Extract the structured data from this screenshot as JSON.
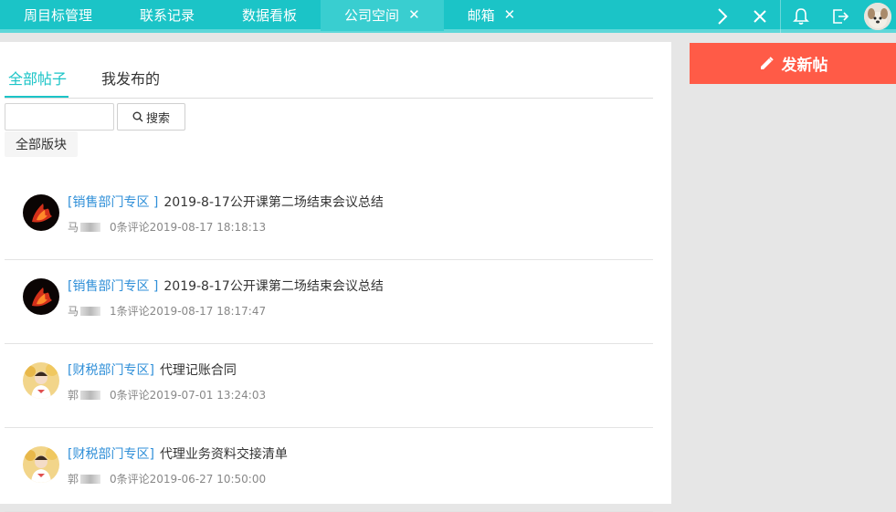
{
  "topnav": {
    "tabs": [
      {
        "label": "周目标管理"
      },
      {
        "label": "联系记录"
      },
      {
        "label": "数据看板"
      },
      {
        "label": "公司空间",
        "closable": true,
        "active": true
      },
      {
        "label": "邮箱",
        "closable": true
      }
    ],
    "icons": [
      "chevron-right-icon",
      "close-icon",
      "bell-icon",
      "logout-icon"
    ]
  },
  "tabs": {
    "all": "全部帖子",
    "mine": "我发布的"
  },
  "search": {
    "placeholder": "",
    "button": "搜索"
  },
  "board_filter": "全部版块",
  "posts": [
    {
      "board": "[销售部门专区 ]",
      "title": "2019-8-17公开课第二场结束会议总结",
      "author": "马",
      "comments": "0条评论",
      "time": "2019-08-17 18:18:13"
    },
    {
      "board": "[销售部门专区 ]",
      "title": "2019-8-17公开课第二场结束会议总结",
      "author": "马",
      "comments": "1条评论",
      "time": "2019-08-17 18:17:47"
    },
    {
      "board": "[财税部门专区]",
      "title": "代理记账合同",
      "author": "郭",
      "comments": "0条评论",
      "time": "2019-07-01 13:24:03"
    },
    {
      "board": "[财税部门专区]",
      "title": "代理业务资料交接清单",
      "author": "郭",
      "comments": "0条评论",
      "time": "2019-06-27 10:50:00"
    }
  ],
  "sidebar": {
    "new_post": "发新帖"
  },
  "colors": {
    "accent": "#1bc4c7",
    "link": "#2f8fd8",
    "new_post": "#ff5b47"
  }
}
